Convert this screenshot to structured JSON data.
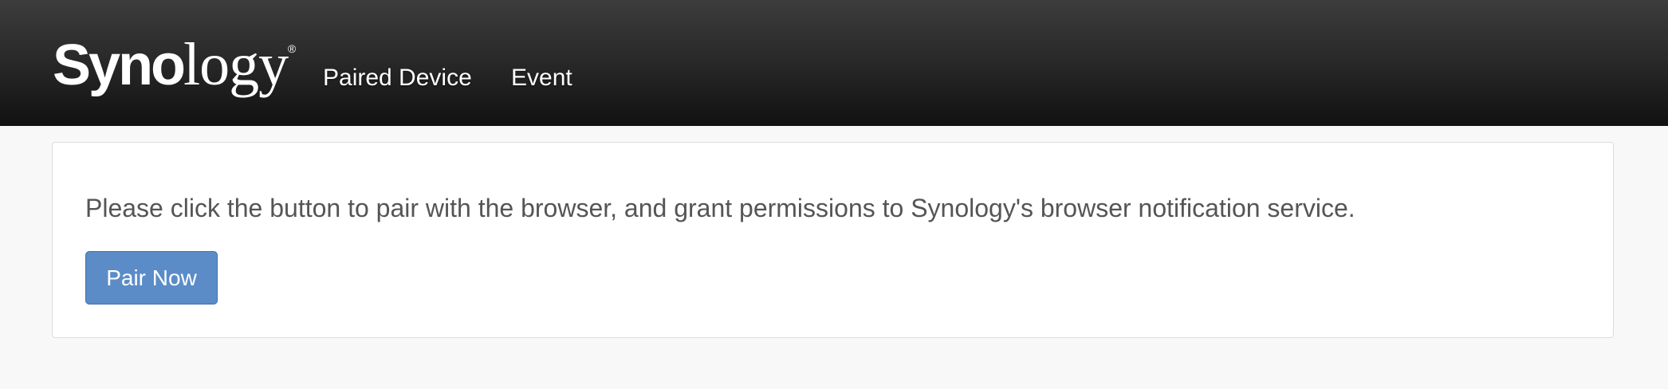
{
  "header": {
    "brand": {
      "bold_part": "Syno",
      "light_part": "logy",
      "registered_mark": "®"
    },
    "nav": [
      {
        "label": "Paired Device"
      },
      {
        "label": "Event"
      }
    ]
  },
  "main": {
    "message": "Please click the button to pair with the browser, and grant permissions to Synology's browser notification service.",
    "pair_button_label": "Pair Now"
  },
  "colors": {
    "navbar": "#1e1e1e",
    "page_background": "#f8f8f8",
    "panel_background": "#ffffff",
    "button": "#5b8cc8",
    "text": "#555555"
  }
}
